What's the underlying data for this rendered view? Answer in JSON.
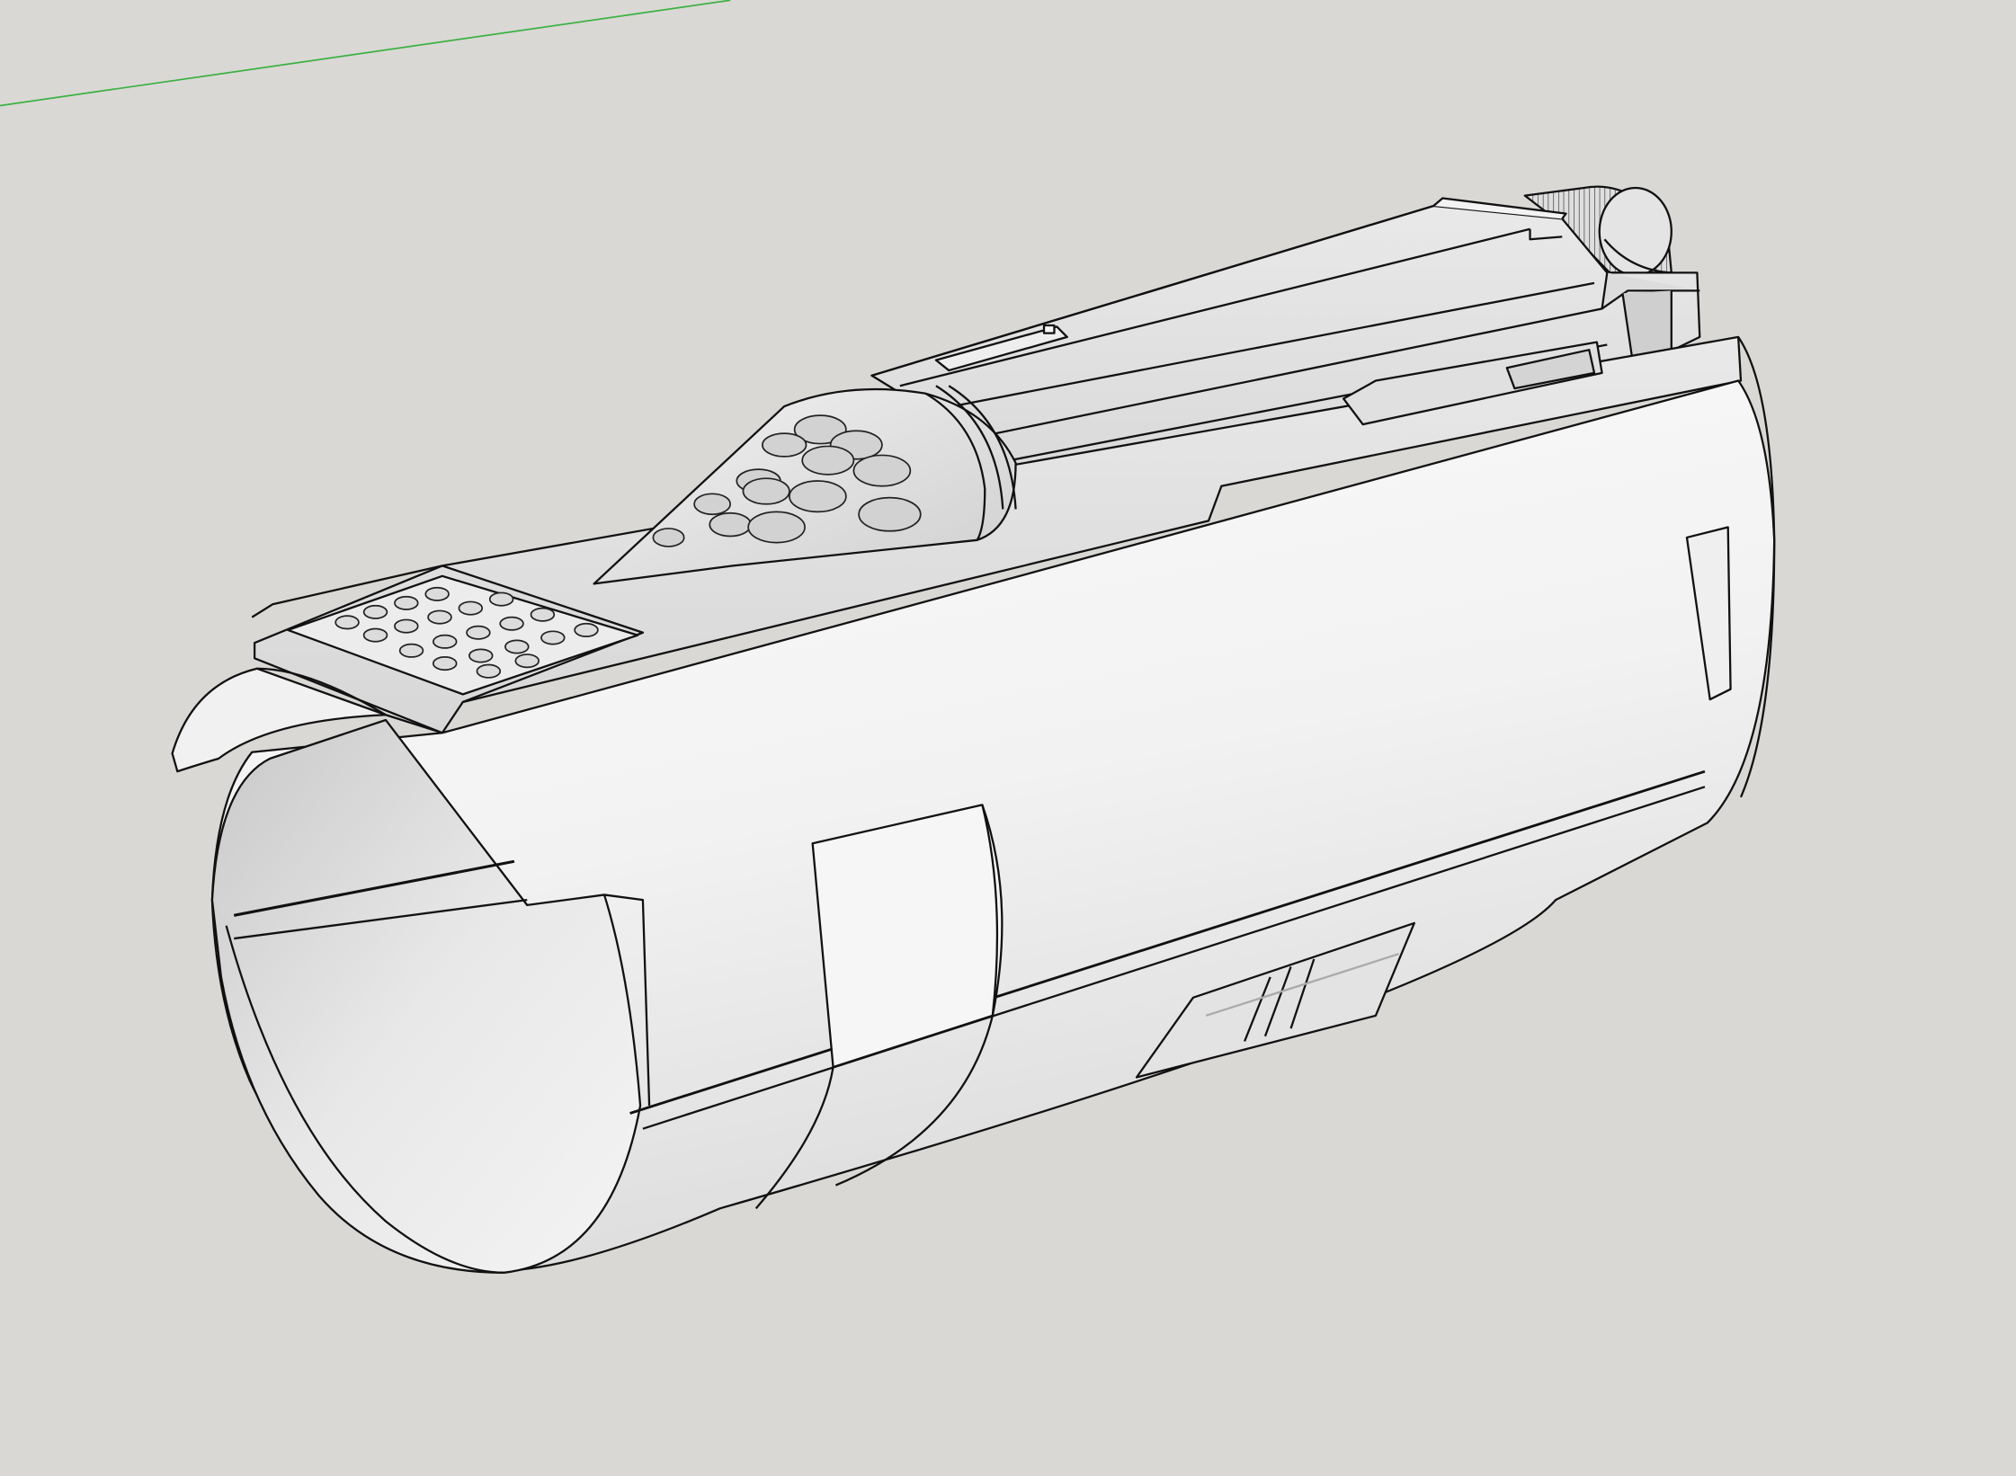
{
  "viewport": {
    "background": "#d9d8d4",
    "axis_color": "#3cb043",
    "edge_color": "#111111",
    "face_light": "#f8f8f8",
    "face_mid": "#e6e6e6",
    "face_dark": "#c8c8c8"
  },
  "model": {
    "parts": [
      "cylindrical-shell",
      "raised-top-rail",
      "upper-housing",
      "perforated-cone",
      "grid-panel-with-studs",
      "knurled-end-knob",
      "side-slot-vent",
      "cutout-tabs"
    ]
  }
}
